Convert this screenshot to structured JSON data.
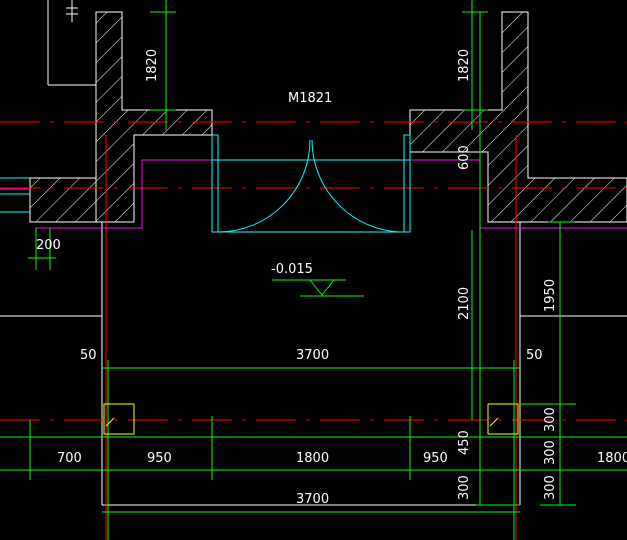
{
  "drawing": {
    "door_label": "M1821",
    "elevation_label": "-0.015",
    "dimensions": {
      "wall_left_1820": "1820",
      "wall_right_1820": "1820",
      "d200": "200",
      "d600": "600",
      "d2100": "2100",
      "d1950": "1950",
      "d50_left": "50",
      "d50_right": "50",
      "span_3700_top": "3700",
      "d700": "700",
      "d950_left": "950",
      "d1800": "1800",
      "d950_right": "950",
      "d450": "450",
      "d300_a": "300",
      "d300_b": "300",
      "d300_c": "300",
      "d300_low": "300",
      "d1800_right": "1800",
      "span_3700_bottom": "3700"
    },
    "colors": {
      "background": "#000000",
      "wall": "#ffffff",
      "dimension": "#00ff00",
      "axis": "#ff0000",
      "door": "#00ffff",
      "magenta": "#ff00ff",
      "column": "#ffff00"
    }
  }
}
